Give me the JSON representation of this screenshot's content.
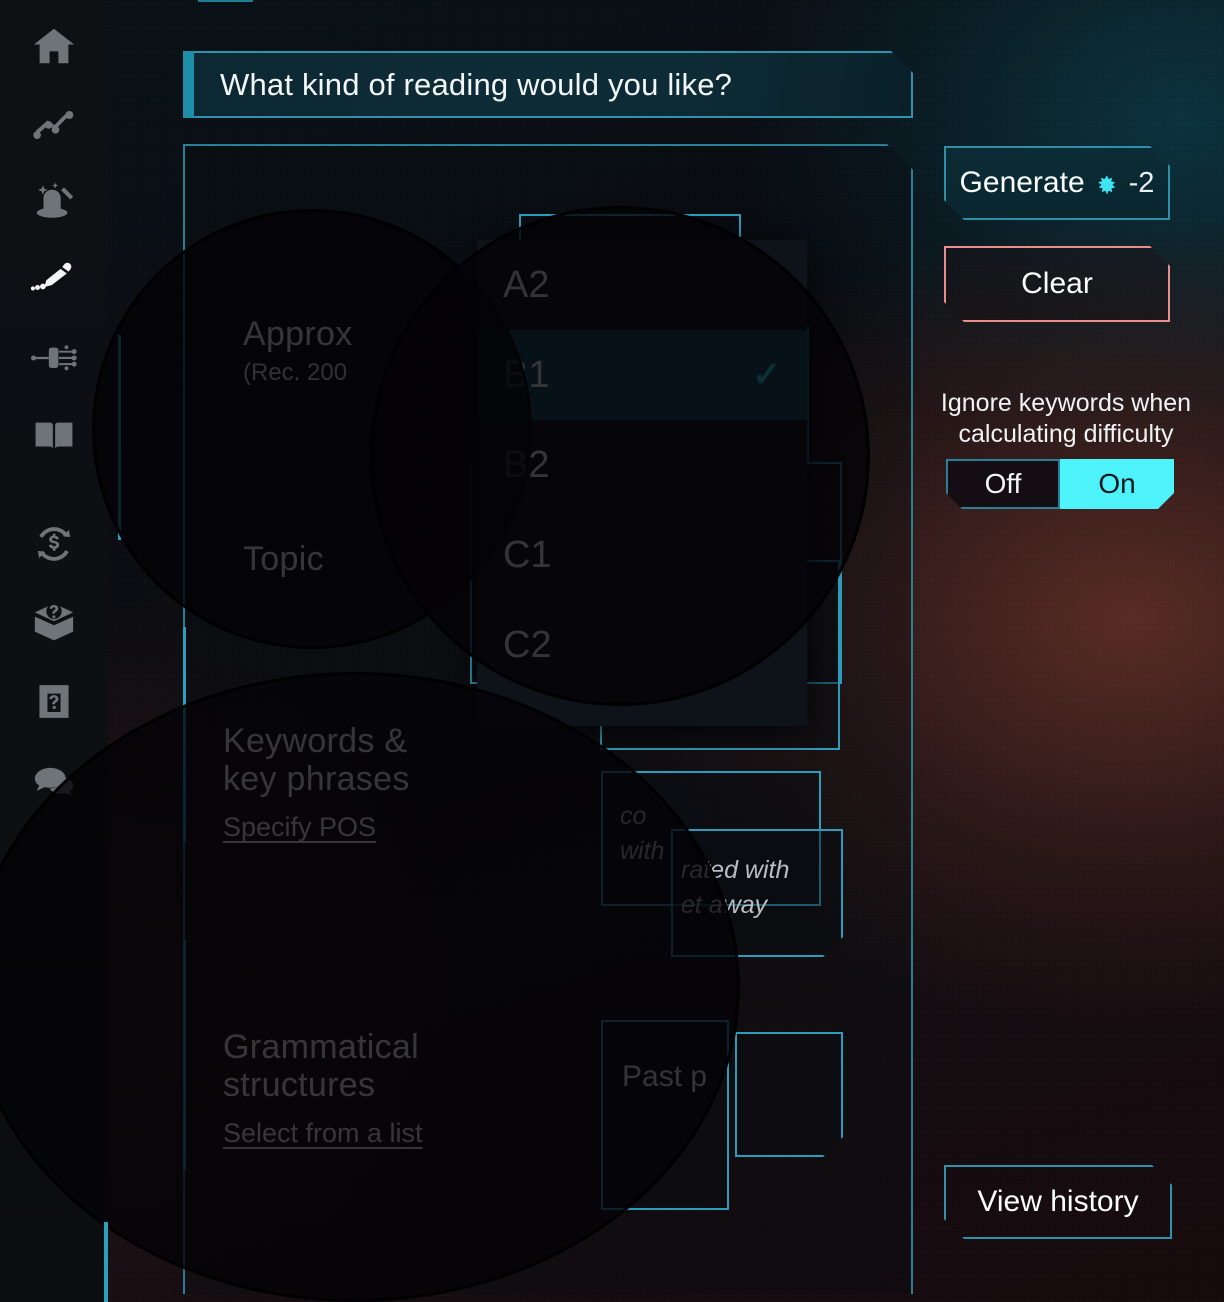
{
  "app": {
    "accent_teal": "#2e9ec0",
    "accent_cyan": "#4df2fb",
    "accent_red": "#e98d8d"
  },
  "sidebar": {
    "items": [
      {
        "label": "Home",
        "icon": "home-icon"
      },
      {
        "label": "Stats",
        "icon": "line-chart-icon"
      },
      {
        "label": "Magic",
        "icon": "magic-hat-icon"
      },
      {
        "label": "Write",
        "icon": "pencil-icon"
      },
      {
        "label": "Network",
        "icon": "neural-network-icon"
      },
      {
        "label": "Read",
        "icon": "open-book-icon"
      },
      {
        "label": "Credits",
        "icon": "coin-refresh-icon"
      },
      {
        "label": "Mystery box",
        "icon": "question-box-icon"
      },
      {
        "label": "Help",
        "icon": "question-card-icon"
      },
      {
        "label": "Chat",
        "icon": "speech-bubbles-icon"
      }
    ]
  },
  "header": {
    "title": "What kind of reading would you like?"
  },
  "form": {
    "length": {
      "label": "Approx",
      "sub": "(Rec. 200",
      "value": ""
    },
    "topic": {
      "label": "Topic",
      "value": ""
    },
    "keywords": {
      "label": "Keywords &\nkey phrases",
      "link": "Specify POS",
      "placeholder_a": "co\nwith",
      "placeholder_b": "rated with\net away"
    },
    "grammar": {
      "label": "Grammatical\nstructures",
      "link": "Select from a list",
      "value": "Past p"
    }
  },
  "dropdown": {
    "name": "cefr-level-select",
    "selected": "B1",
    "check_glyph": "✓",
    "options": [
      {
        "label": "A2",
        "selected": false
      },
      {
        "label": "B1",
        "selected": true
      },
      {
        "label": "B2",
        "selected": false
      },
      {
        "label": "C1",
        "selected": false
      },
      {
        "label": "C2",
        "selected": false
      }
    ]
  },
  "actions": {
    "generate_label": "Generate",
    "generate_cost": "-2",
    "generate_icon": "leaf-token-icon",
    "clear_label": "Clear",
    "history_label": "View history"
  },
  "toggle": {
    "caption": "Ignore keywords when calculating difficulty",
    "off_label": "Off",
    "on_label": "On",
    "state": "On"
  }
}
